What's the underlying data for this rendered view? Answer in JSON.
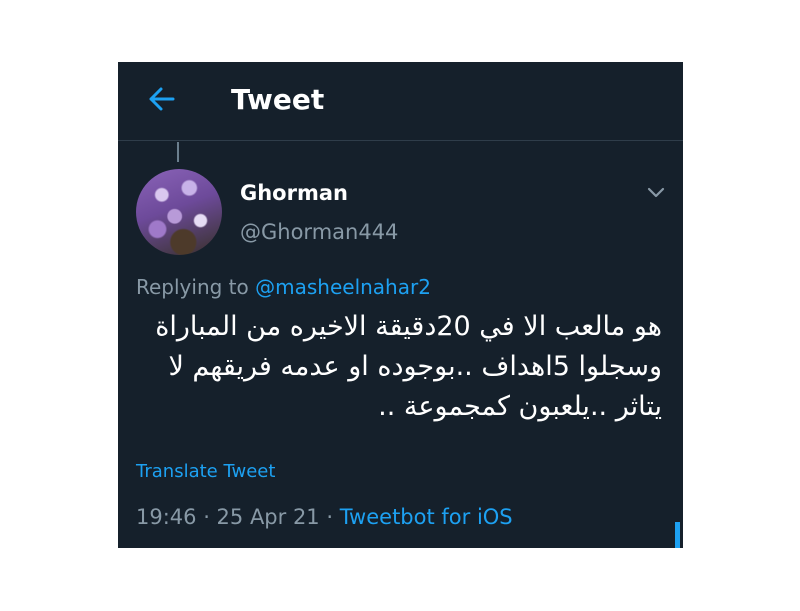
{
  "header": {
    "title": "Tweet"
  },
  "tweet": {
    "author_name": "Ghorman",
    "author_handle": "@Ghorman444",
    "replying_prefix": "Replying to",
    "replying_to": "@masheelnahar2",
    "text": "هو مالعب الا في 20دقيقة الاخيره من المباراة وسجلوا 5اهداف ..بوجوده او عدمه فريقهم لا يتاثر ..يلعبون كمجموعة ..",
    "translate_label": "Translate Tweet",
    "timestamp": "19:46 · 25 Apr 21 · ",
    "source": "Tweetbot for iOS"
  },
  "colors": {
    "background": "#15202b",
    "accent": "#1da1f2",
    "secondary_text": "#8899a6"
  },
  "icons": {
    "back": "arrow-left-icon",
    "more": "chevron-down-icon"
  }
}
